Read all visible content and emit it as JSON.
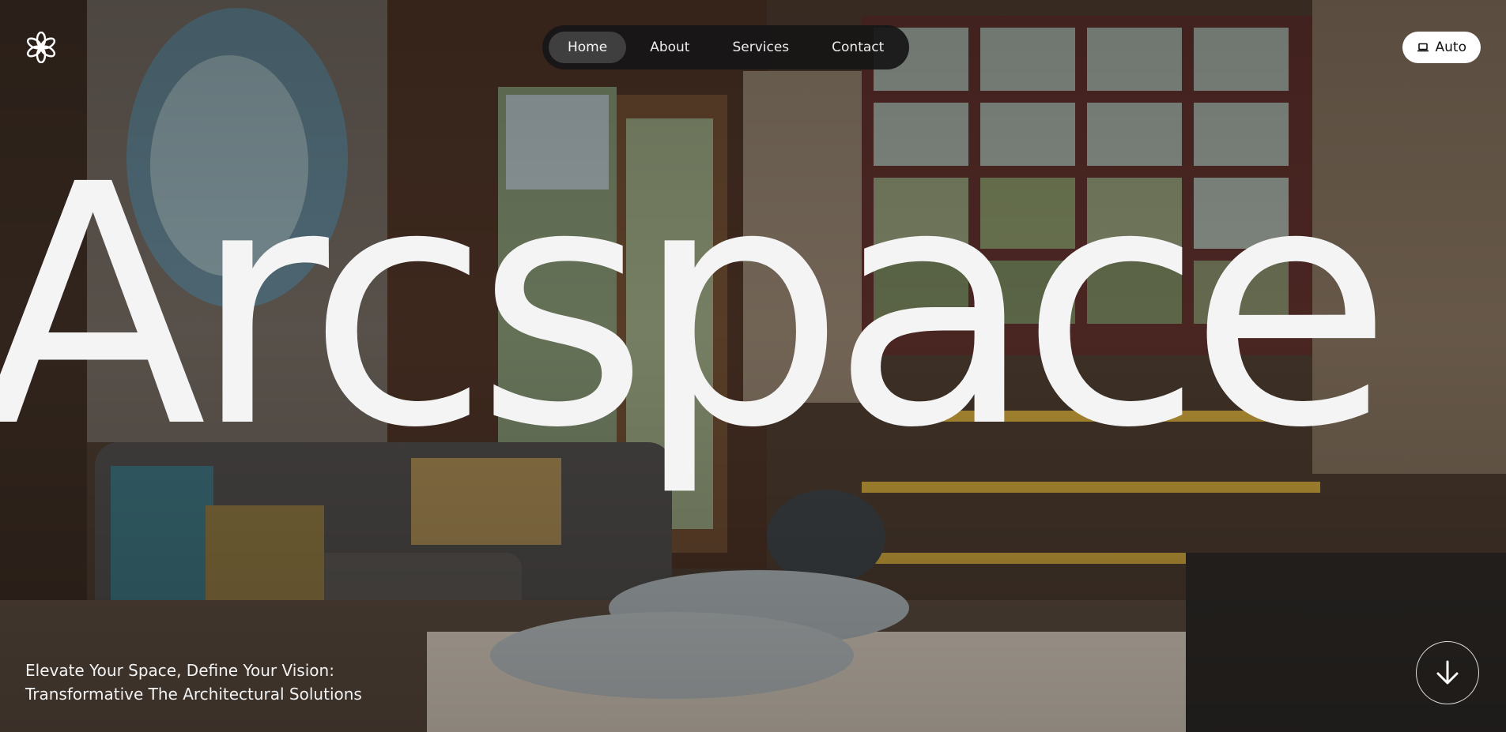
{
  "brand": {
    "wordmark": "Arcspace",
    "logo_icon": "flower-asterisk-icon"
  },
  "nav": {
    "items": [
      {
        "label": "Home",
        "active": true
      },
      {
        "label": "About",
        "active": false
      },
      {
        "label": "Services",
        "active": false
      },
      {
        "label": "Contact",
        "active": false
      }
    ]
  },
  "theme_toggle": {
    "label": "Auto",
    "icon": "laptop-icon"
  },
  "tagline": {
    "line1": "Elevate Your Space, Define Your Vision:",
    "line2": "Transformative The Architectural Solutions"
  },
  "scroll_button": {
    "icon": "arrow-down-icon"
  },
  "colors": {
    "wordmark": "#f4f4f4",
    "nav_background": "#161616",
    "nav_active": "#464646",
    "button_background": "#ffffff"
  }
}
